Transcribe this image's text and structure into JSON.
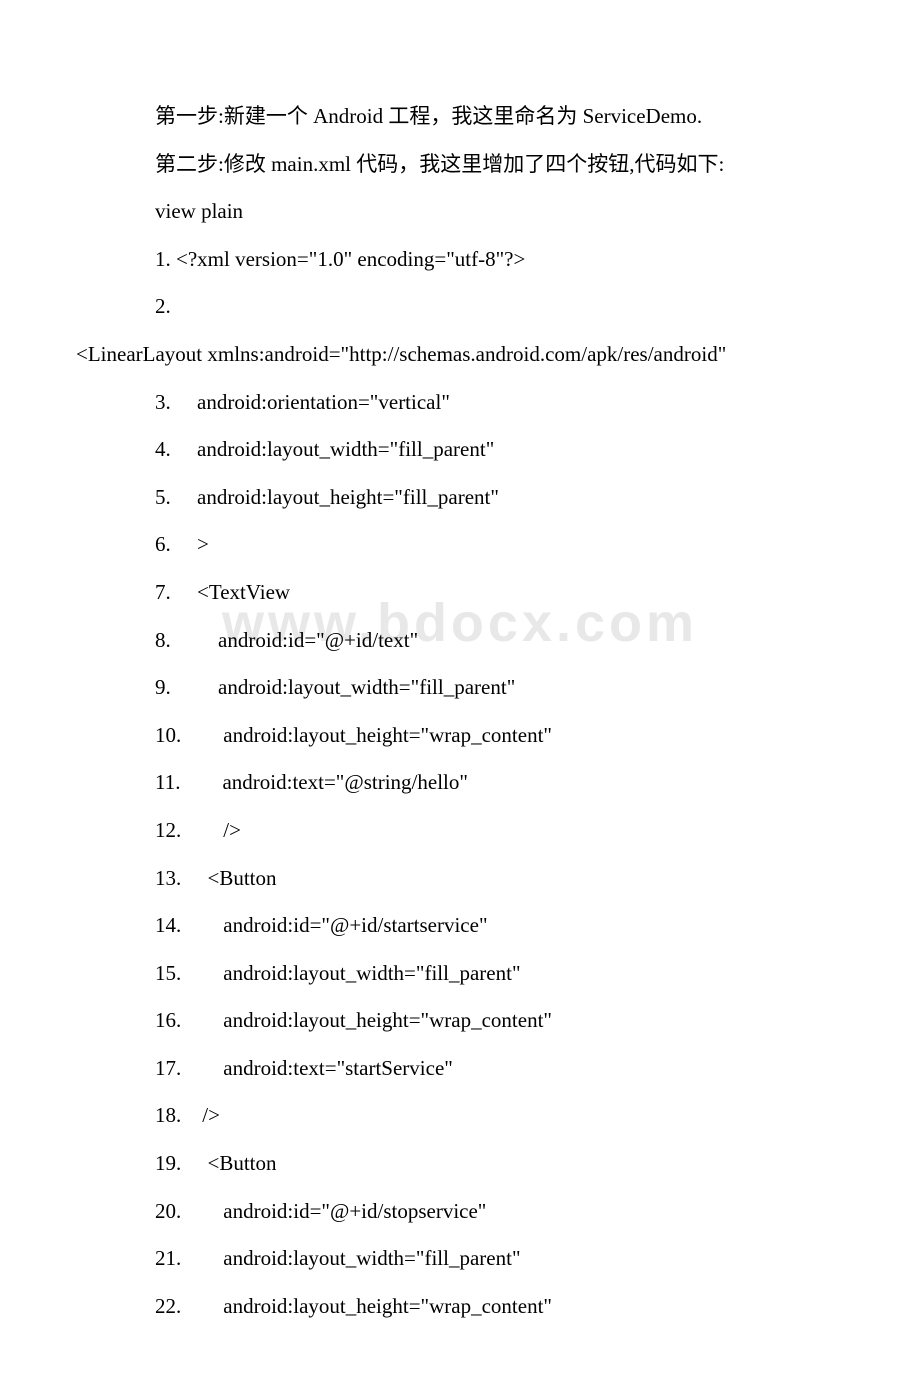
{
  "watermark": "www.bdocx.com",
  "intro": {
    "step1": "第一步:新建一个 Android 工程，我这里命名为 ServiceDemo.",
    "step2": "第二步:修改 main.xml 代码，我这里增加了四个按钮,代码如下:",
    "viewplain": "view plain"
  },
  "code": {
    "l1_pre": "1. ",
    "l1": "<?xml version=\"1.0\" encoding=\"utf-8\"?>",
    "l2_pre": "2. ",
    "l2_wrap": "<LinearLayout xmlns:android=\"http://schemas.android.com/apk/res/android\"",
    "l3": "3.     android:orientation=\"vertical\"",
    "l4": "4.     android:layout_width=\"fill_parent\"",
    "l5": "5.     android:layout_height=\"fill_parent\"",
    "l6": "6.     >",
    "l7": "7.     <TextView",
    "l8": "8.         android:id=\"@+id/text\"",
    "l9": "9.         android:layout_width=\"fill_parent\"",
    "l10": "10.        android:layout_height=\"wrap_content\"",
    "l11": "11.        android:text=\"@string/hello\"",
    "l12": "12.        />",
    "l13": "13.     <Button",
    "l14": "14.        android:id=\"@+id/startservice\"",
    "l15": "15.        android:layout_width=\"fill_parent\"",
    "l16": "16.        android:layout_height=\"wrap_content\"",
    "l17": "17.        android:text=\"startService\"",
    "l18": "18.    />",
    "l19": "19.     <Button",
    "l20": "20.        android:id=\"@+id/stopservice\"",
    "l21": "21.        android:layout_width=\"fill_parent\"",
    "l22": "22.        android:layout_height=\"wrap_content\""
  }
}
